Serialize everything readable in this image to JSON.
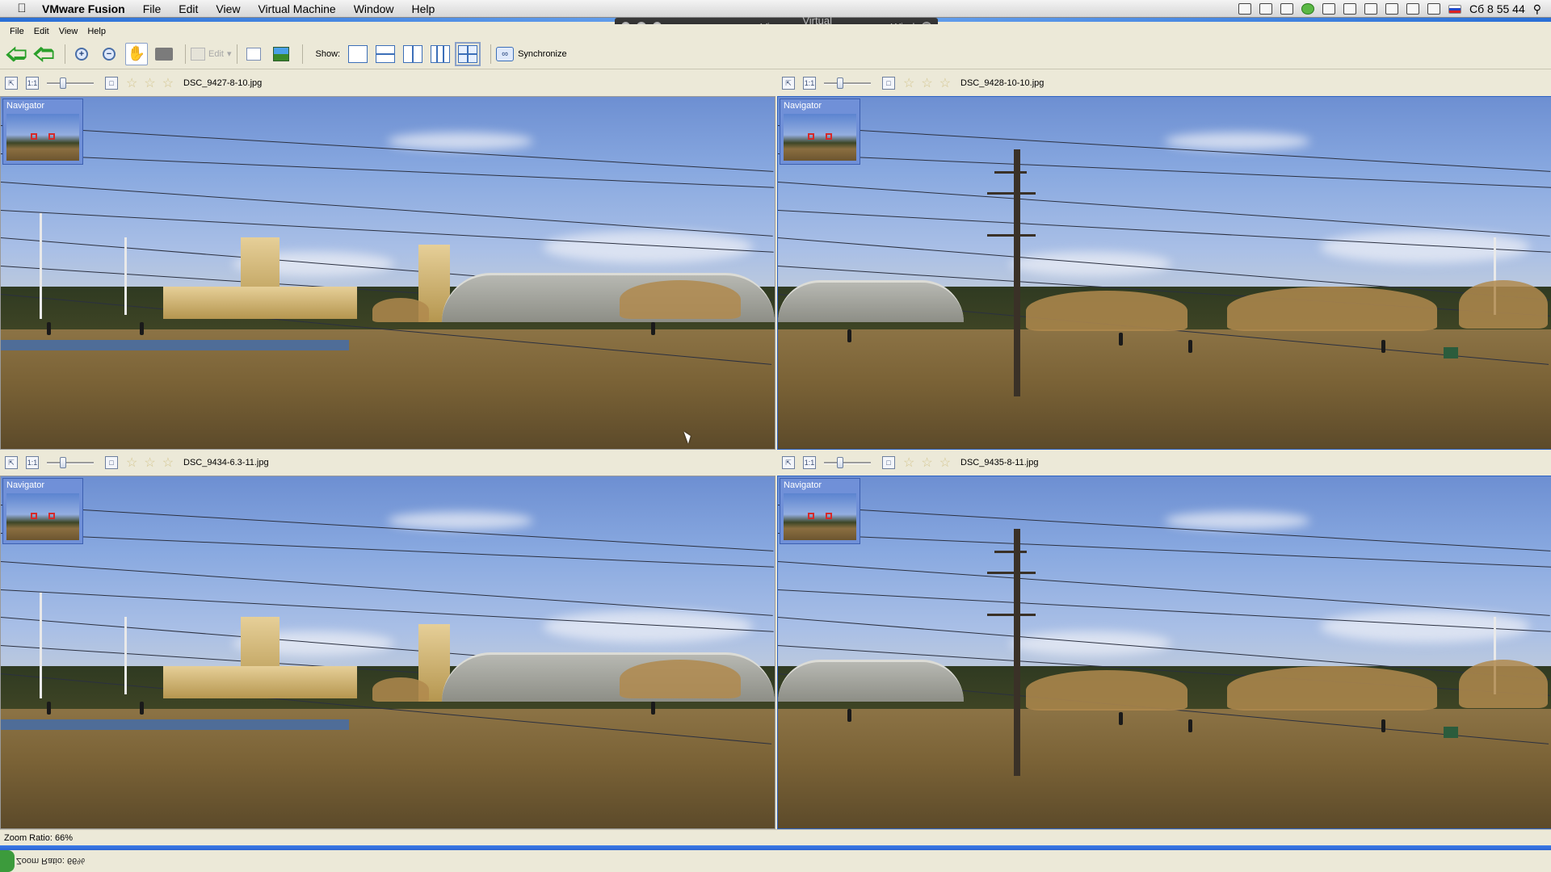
{
  "mac_menubar": {
    "app_name": "VMware Fusion",
    "menus": [
      "File",
      "Edit",
      "View",
      "Virtual Machine",
      "Window",
      "Help"
    ],
    "clock": "Сб 8 55 44"
  },
  "vm_float_toolbar": {
    "menus": [
      "View",
      "Virtual Machine",
      "Window"
    ]
  },
  "app_menubar": {
    "menus": [
      "File",
      "Edit",
      "View",
      "Help"
    ]
  },
  "toolbar": {
    "edit_label": "Edit",
    "show_label": "Show:",
    "sync_label": "Synchronize"
  },
  "panes": [
    {
      "filename": "DSC_9427-8-10.jpg",
      "navigator_label": "Navigator"
    },
    {
      "filename": "DSC_9428-10-10.jpg",
      "navigator_label": "Navigator"
    },
    {
      "filename": "DSC_9434-6.3-11.jpg",
      "navigator_label": "Navigator"
    },
    {
      "filename": "DSC_9435-8-11.jpg",
      "navigator_label": "Navigator"
    }
  ],
  "status_bar": {
    "zoom_text": "Zoom Ratio: 66%"
  },
  "taskbar": {
    "mirrored_text": "Zoom Ratio: 66%"
  }
}
